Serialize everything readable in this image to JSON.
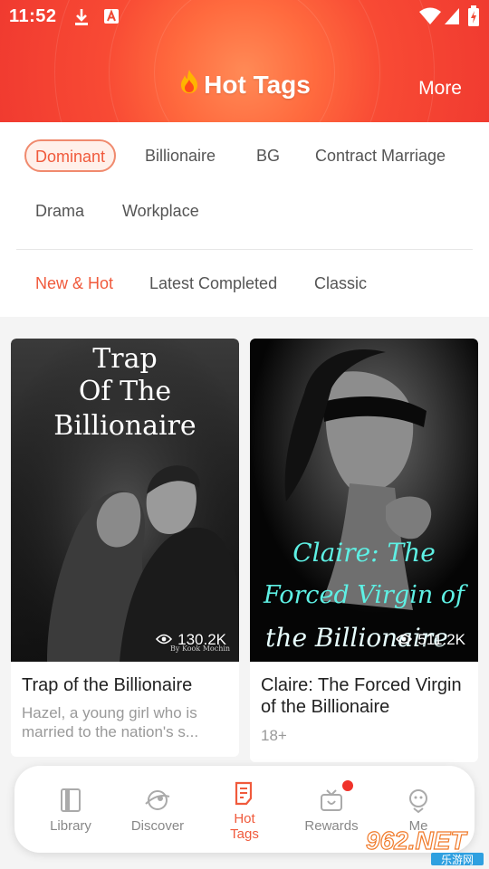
{
  "status_bar": {
    "time": "11:52"
  },
  "header": {
    "title": "Hot Tags",
    "more_label": "More"
  },
  "tags": [
    "Dominant",
    "Billionaire",
    "BG",
    "Contract Marriage",
    "Drama",
    "Workplace"
  ],
  "active_tag": "Dominant",
  "subtabs": [
    "New & Hot",
    "Latest Completed",
    "Classic"
  ],
  "active_subtab": "New & Hot",
  "books": [
    {
      "cover_title_lines": [
        "Trap",
        "Of The",
        "Billionaire"
      ],
      "cover_author": "By Kook Mochin",
      "views": "130.2K",
      "title": "Trap of the Billionaire",
      "description": "Hazel, a young girl who is married to the nation's s..."
    },
    {
      "cover_title_lines": [
        "Claire: The",
        "Forced Virgin of",
        "the Billionaire"
      ],
      "views": "511.2K",
      "title": "Claire: The Forced Virgin of the Billionaire",
      "age": "18+"
    }
  ],
  "nav": [
    {
      "label": "Library",
      "icon": "book-icon"
    },
    {
      "label": "Discover",
      "icon": "planet-icon"
    },
    {
      "label": "Hot Tags",
      "icon": "tag-document-icon",
      "active": true
    },
    {
      "label": "Rewards",
      "icon": "gift-tv-icon",
      "badge": true
    },
    {
      "label": "Me",
      "icon": "avatar-icon"
    }
  ],
  "watermark": {
    "text": "962.NET",
    "subtext": "乐游网"
  },
  "colors": {
    "accent": "#f05a3c",
    "header_start": "#ff8a56",
    "header_end": "#f03a30"
  }
}
